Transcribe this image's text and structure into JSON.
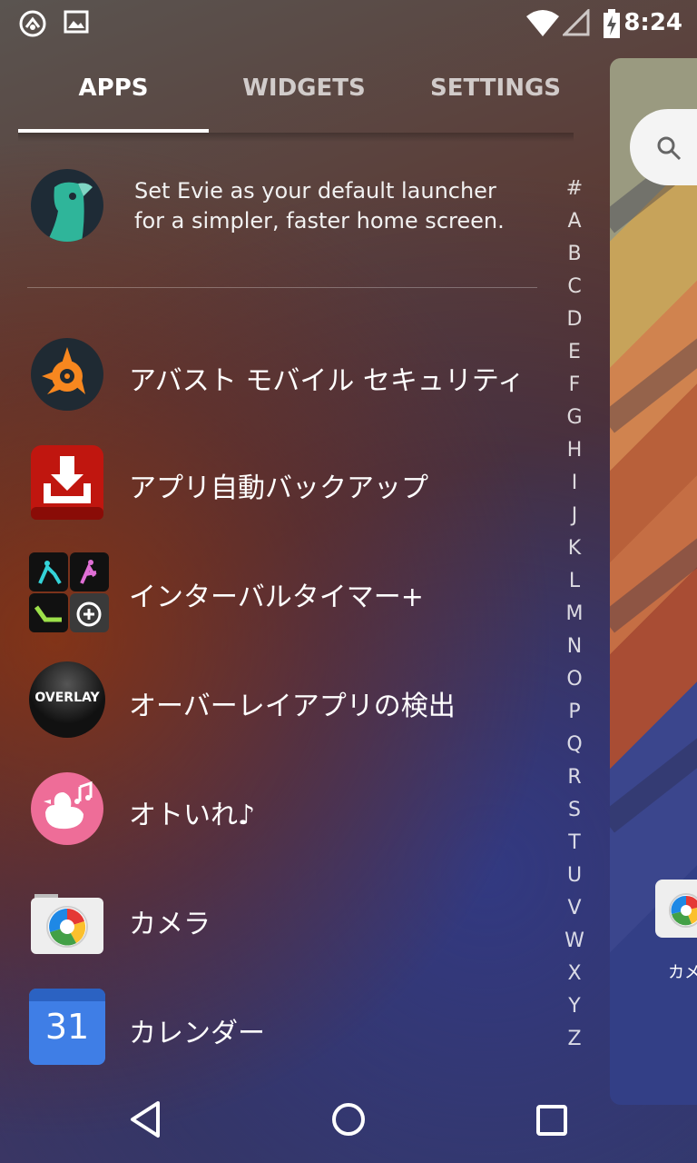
{
  "status_bar": {
    "time": "8:24",
    "left_icons": [
      "speed-dial-notification-icon",
      "image-notification-icon"
    ],
    "right_icons": [
      "wifi-icon",
      "cellular-signal-icon",
      "battery-charging-icon"
    ]
  },
  "tabs": [
    {
      "label": "APPS",
      "active": true
    },
    {
      "label": "WIDGETS",
      "active": false
    },
    {
      "label": "SETTINGS",
      "active": false
    }
  ],
  "promo": {
    "line1": "Set Evie as your default launcher",
    "line2": "for a simpler, faster home screen."
  },
  "apps": [
    {
      "label": "アバスト モバイル セキュリティ",
      "icon": "avast-icon"
    },
    {
      "label": "アプリ自動バックアップ",
      "icon": "backup-download-icon"
    },
    {
      "label": "インターバルタイマー+",
      "icon": "interval-timer-icon"
    },
    {
      "label": "オーバーレイアプリの検出",
      "icon": "overlay-icon",
      "icon_text": "OVERLAY"
    },
    {
      "label": "オトいれ♪",
      "icon": "duck-music-icon"
    },
    {
      "label": "カメラ",
      "icon": "camera-icon"
    },
    {
      "label": "カレンダー",
      "icon": "calendar-icon",
      "icon_text": "31"
    }
  ],
  "az_index": [
    "#",
    "A",
    "B",
    "C",
    "D",
    "E",
    "F",
    "G",
    "H",
    "I",
    "J",
    "K",
    "L",
    "M",
    "N",
    "O",
    "P",
    "Q",
    "R",
    "S",
    "T",
    "U",
    "V",
    "W",
    "X",
    "Y",
    "Z"
  ],
  "home_preview": {
    "camera_label": "カメ"
  },
  "nav": {
    "buttons": [
      "back-icon",
      "home-icon",
      "recents-icon"
    ]
  },
  "colors": {
    "tab_underline": "#ffffff",
    "avast_orange": "#f7871f",
    "backup_red": "#c0160f",
    "calendar_blue": "#3f7ee6",
    "duck_pink": "#ee6d98"
  }
}
